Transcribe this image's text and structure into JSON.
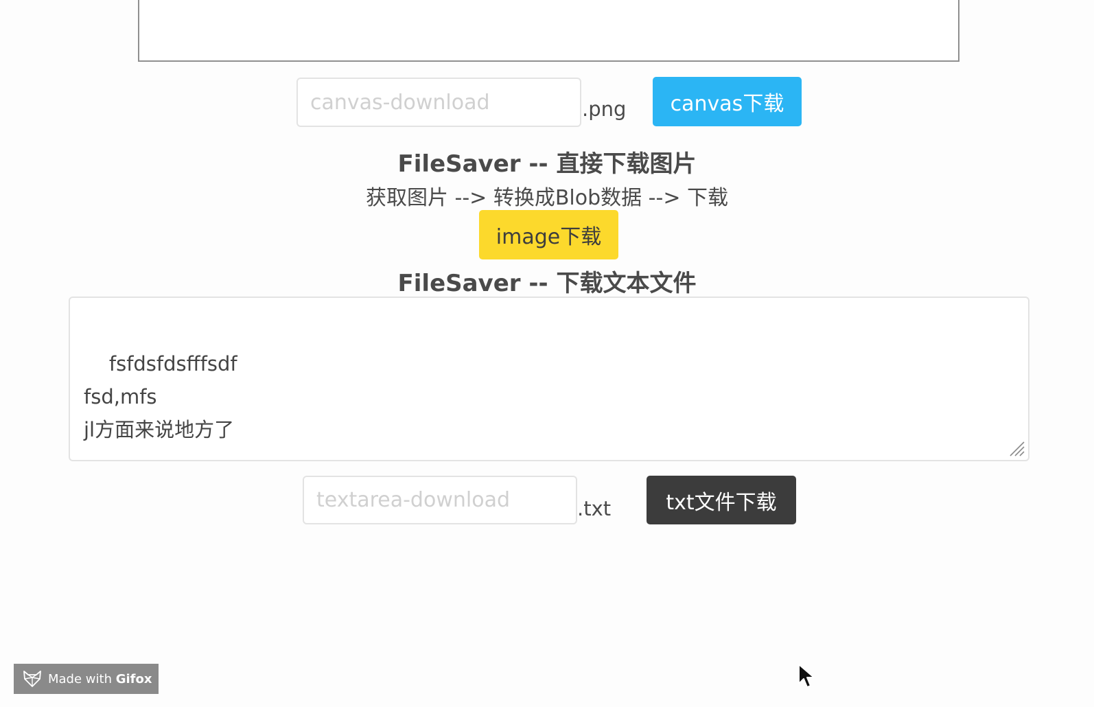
{
  "canvas_section": {
    "filename_placeholder": "canvas-download",
    "extension": ".png",
    "download_button": "canvas下载"
  },
  "image_section": {
    "title": "FileSaver -- 直接下载图片",
    "description": "获取图片 --> 转换成Blob数据 --> 下载",
    "download_button": "image下载"
  },
  "text_section": {
    "title": "FileSaver -- 下载文本文件",
    "textarea_content": "fsfdsfdsfffsdf\nfsd,mfs\njl方面来说地方了",
    "filename_placeholder": "textarea-download",
    "extension": ".txt",
    "download_button": "txt文件下载"
  },
  "watermark": {
    "prefix": "Made with ",
    "brand": "Gifox",
    "icon": "gifox-fox-icon"
  },
  "colors": {
    "canvas_button": "#2bb5f4",
    "image_button": "#fcd92c",
    "txt_button": "#3c3c3c"
  }
}
